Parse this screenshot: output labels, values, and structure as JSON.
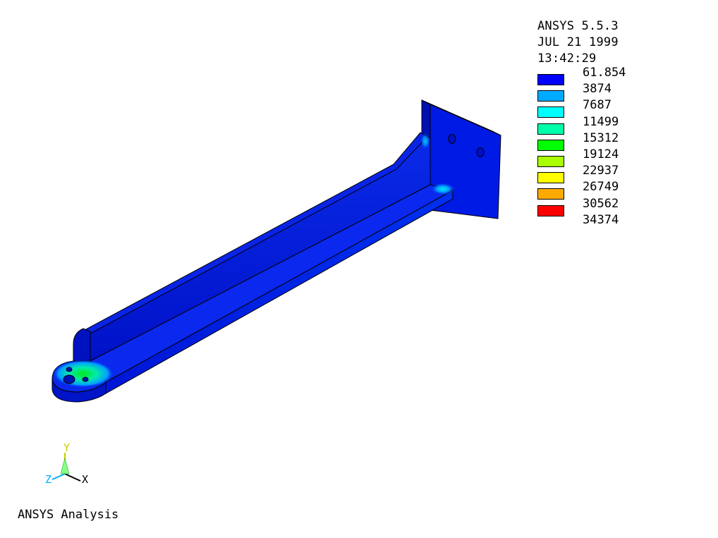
{
  "header": {
    "program": "ANSYS 5.5.3",
    "date": "JUL 21 1999",
    "time": "13:42:29"
  },
  "contour_legend": [
    {
      "value": "61.854",
      "color": "#0000ff"
    },
    {
      "value": "3874",
      "color": "#00aaff"
    },
    {
      "value": "7687",
      "color": "#00ffff"
    },
    {
      "value": "11499",
      "color": "#00ffaa"
    },
    {
      "value": "15312",
      "color": "#00ff00"
    },
    {
      "value": "19124",
      "color": "#aaff00"
    },
    {
      "value": "22937",
      "color": "#ffff00"
    },
    {
      "value": "26749",
      "color": "#ffaa00"
    },
    {
      "value": "30562",
      "color": "#ff0000"
    },
    {
      "value": "34374",
      "color": null
    }
  ],
  "triad": {
    "x_label": "X",
    "y_label": "Y",
    "z_label": "Z",
    "x_color": "#000000",
    "y_color": "#cccc00",
    "z_color": "#00aaff"
  },
  "caption": "ANSYS Analysis",
  "model": {
    "base_color": "#0018e8",
    "highlight_colors": [
      "#00aaff",
      "#00ffaa",
      "#00ff00"
    ]
  }
}
